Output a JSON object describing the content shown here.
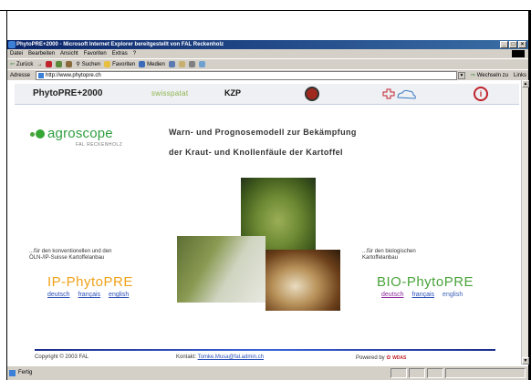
{
  "browser": {
    "title": "PhytoPRE+2000 - Microsoft Internet Explorer bereitgestellt von FAL Reckenholz",
    "menu": [
      "Datei",
      "Bearbeiten",
      "Ansicht",
      "Favoriten",
      "Extras",
      "?"
    ],
    "toolbar": {
      "back": "Zurück",
      "search": "Suchen",
      "favorites": "Favoriten",
      "media": "Medien"
    },
    "address_label": "Adresse",
    "address_value": "http://www.phytopre.ch",
    "go_label": "Wechseln zu",
    "links_label": "Links",
    "status": "Fertig"
  },
  "nav": {
    "title": "PhytoPRE+2000",
    "swisspatat": "swisspatat",
    "kzp": "KZP"
  },
  "logo": {
    "name": "agroscope",
    "sub": "FAL RECKENHOLZ"
  },
  "headline": {
    "line1": "Warn- und Prognosemodell zur Bekämpfung",
    "line2": "der Kraut- und Knollenfäule der Kartoffel"
  },
  "ip": {
    "desc_line1": "...für den konventionellen und den",
    "desc_line2": "ÖLN-/IP-Suisse Kartoffelanbau",
    "title": "IP-PhytoPRE",
    "langs": [
      "deutsch",
      "français",
      "english"
    ]
  },
  "bio": {
    "desc_line1": "...für den biologischen",
    "desc_line2": "Kartoffelanbau",
    "title": "BIO-PhytoPRE",
    "langs": [
      "deutsch",
      "français",
      "english"
    ]
  },
  "footer": {
    "copyright": "Copyright © 2003 FAL",
    "contact_label": "Kontakt:",
    "contact_link": "Tomke.Musa@fal.admin.ch",
    "powered_label": "Powered by",
    "powered_brand": "WDAS"
  }
}
